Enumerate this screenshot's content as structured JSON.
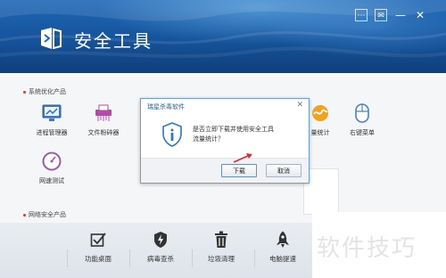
{
  "app": {
    "title": "安全工具"
  },
  "window_controls": [
    "⋯",
    "✉",
    "—",
    "✕"
  ],
  "sections": [
    {
      "label": "系统优化产品"
    },
    {
      "label": "网络安全产品"
    }
  ],
  "tools": [
    {
      "label": "进程管理器",
      "icon": "process-manager-icon"
    },
    {
      "label": "文件粉碎器",
      "icon": "file-shredder-icon"
    },
    {
      "label": "网速测试",
      "icon": "speed-test-icon"
    },
    {
      "label": "量统计",
      "icon": "traffic-stats-icon"
    },
    {
      "label": "右键菜单",
      "icon": "mouse-icon"
    }
  ],
  "bottom_bar": [
    {
      "label": "功能桌面",
      "icon": "checkbox-icon"
    },
    {
      "label": "病毒查杀",
      "icon": "shield-bolt-icon"
    },
    {
      "label": "垃圾清理",
      "icon": "trash-icon"
    },
    {
      "label": "电脑提速",
      "icon": "rocket-icon"
    }
  ],
  "dialog": {
    "title": "瑞星杀毒软件",
    "message_line1": "是否立即下载并使用安全工具",
    "message_line2": "流量统计？",
    "ok_label": "下载",
    "cancel_label": "取消",
    "close": "✕"
  },
  "watermark": {
    "text": "软件技巧"
  },
  "colors": {
    "header_top": "#1f67b6",
    "header_bottom": "#0f3f7a",
    "accent": "#2a6fc0",
    "alert": "#d23a3a"
  }
}
